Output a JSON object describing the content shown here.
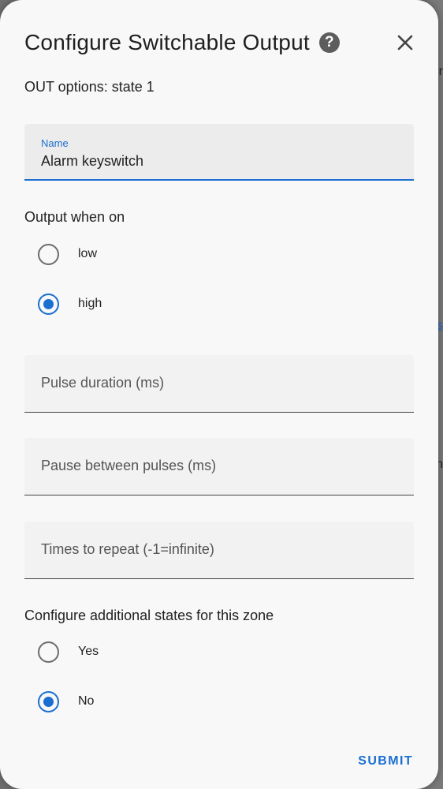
{
  "dialog": {
    "title": "Configure Switchable Output",
    "subtitle": "OUT options: state 1",
    "submit_label": "SUBMIT"
  },
  "name_field": {
    "label": "Name",
    "value": "Alarm keyswitch"
  },
  "output_when_on": {
    "label": "Output when on",
    "options": [
      {
        "label": "low",
        "checked": false
      },
      {
        "label": "high",
        "checked": true
      }
    ]
  },
  "pulse_duration": {
    "placeholder": "Pulse duration (ms)"
  },
  "pause_between_pulses": {
    "placeholder": "Pause between pulses (ms)"
  },
  "times_to_repeat": {
    "placeholder": "Times to repeat (-1=infinite)"
  },
  "additional_states": {
    "label": "Configure additional states for this zone",
    "options": [
      {
        "label": "Yes",
        "checked": false
      },
      {
        "label": "No",
        "checked": true
      }
    ]
  },
  "colors": {
    "accent": "#1a6fd1",
    "dialog_background": "#f8f8f8",
    "field_background": "#ececec"
  },
  "icons": {
    "help": "help-icon",
    "close": "close-icon"
  }
}
